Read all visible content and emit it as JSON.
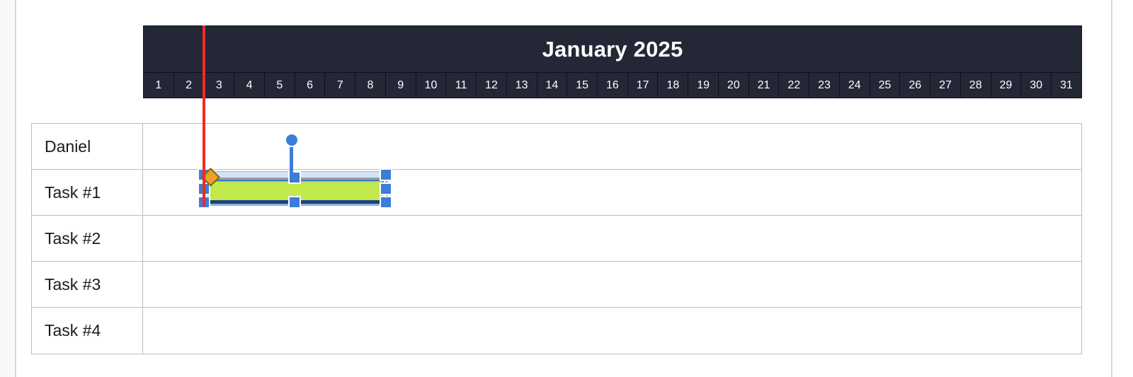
{
  "app": {
    "view_name": "gantt-chart"
  },
  "timeline": {
    "month_title": "January 2025",
    "days": [
      "1",
      "2",
      "3",
      "4",
      "5",
      "6",
      "7",
      "8",
      "9",
      "10",
      "11",
      "12",
      "13",
      "14",
      "15",
      "16",
      "17",
      "18",
      "19",
      "20",
      "21",
      "22",
      "23",
      "24",
      "25",
      "26",
      "27",
      "28",
      "29",
      "30",
      "31"
    ],
    "header_bg": "#242736",
    "header_text_color": "#ffffff"
  },
  "rows": [
    {
      "label": "Daniel"
    },
    {
      "label": "Task #1"
    },
    {
      "label": "Task #2"
    },
    {
      "label": "Task #3"
    },
    {
      "label": "Task #4"
    }
  ],
  "today_marker": {
    "color": "#ef2b24",
    "day": "3"
  },
  "selected_task": {
    "row_label": "Task #1",
    "bar_color": "#c2ea4d",
    "handle_color": "#3b7dd8",
    "progress_marker_color": "#eda327",
    "outline_color": "#9e9e9e",
    "start_day": "3",
    "end_day": "9"
  },
  "link_node": {
    "color": "#3b7dd8"
  }
}
